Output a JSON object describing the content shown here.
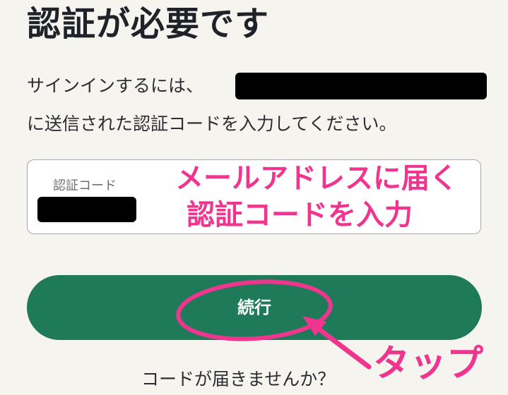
{
  "page": {
    "title": "認証が必要です",
    "instruction_line1": "サインインするには、",
    "instruction_line2": "に送信された認証コードを入力してください。"
  },
  "code_input": {
    "label": "認証コード"
  },
  "continue_button": {
    "label": "続行"
  },
  "resend": {
    "text": "コードが届きませんか？"
  },
  "annotations": {
    "hint_line1": "メールアドレスに届く",
    "hint_line2": "認証コードを入力",
    "tap": "タップ"
  },
  "colors": {
    "background": "#f6f4ef",
    "button": "#1f7a5a",
    "annotation": "#f0358f",
    "redaction": "#000000"
  }
}
